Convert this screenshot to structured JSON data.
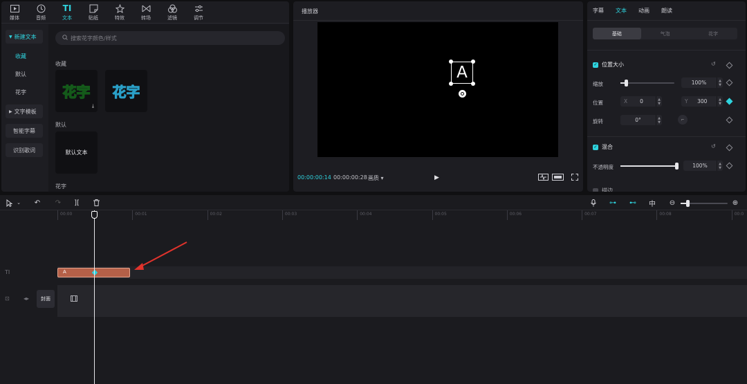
{
  "topnav": [
    {
      "label": "媒体",
      "icon": "media-icon"
    },
    {
      "label": "音频",
      "icon": "audio-icon"
    },
    {
      "label": "文本",
      "icon": "text-icon",
      "active": true
    },
    {
      "label": "贴纸",
      "icon": "sticker-icon"
    },
    {
      "label": "特效",
      "icon": "effects-icon"
    },
    {
      "label": "转场",
      "icon": "transition-icon"
    },
    {
      "label": "滤镜",
      "icon": "filter-icon"
    },
    {
      "label": "调节",
      "icon": "adjust-icon"
    }
  ],
  "sidebar": {
    "new_text": "新建文本",
    "favorites": "收藏",
    "default": "默认",
    "fancy": "花字",
    "templates": "文字模板",
    "smart_caption": "智能字幕",
    "lyrics": "识别歌词"
  },
  "content": {
    "search_placeholder": "搜索花字颜色/样式",
    "section_favorites": "收藏",
    "tile1": "花字",
    "tile2": "花字",
    "section_default": "默认",
    "default_tile": "默认文本",
    "section_fancy": "花字"
  },
  "player": {
    "title": "播放器",
    "letter": "A",
    "time_current": "00:00:00:14",
    "time_total": "00:00:00:28",
    "ratio_label": "画质 ▾"
  },
  "right": {
    "tabs": [
      "字幕",
      "文本",
      "动画",
      "朗读"
    ],
    "active_tab": 1,
    "subtabs": [
      "基础",
      "气泡",
      "花字"
    ],
    "position_size": "位置大小",
    "scale_label": "缩放",
    "scale_value": "100%",
    "scale_level": 0.1,
    "position_label": "位置",
    "x_prefix": "X",
    "x_value": "0",
    "y_prefix": "Y",
    "y_value": "300",
    "rotation_label": "旋转",
    "rotation_value": "0°",
    "blend": "混合",
    "opacity_label": "不透明度",
    "opacity_value": "100%",
    "opacity_level": 1.0,
    "more": "描边"
  },
  "timeline": {
    "ruler_labels": [
      "00:00",
      "00:01",
      "00:02",
      "00:03",
      "00:04",
      "00:05",
      "00:06",
      "00:07",
      "00:08",
      "00:0"
    ],
    "clip_label": "A",
    "cover_label": "封面"
  },
  "colors": {
    "accent": "#2fd3de",
    "clip": "#b46048",
    "arrow": "#e0332c"
  }
}
